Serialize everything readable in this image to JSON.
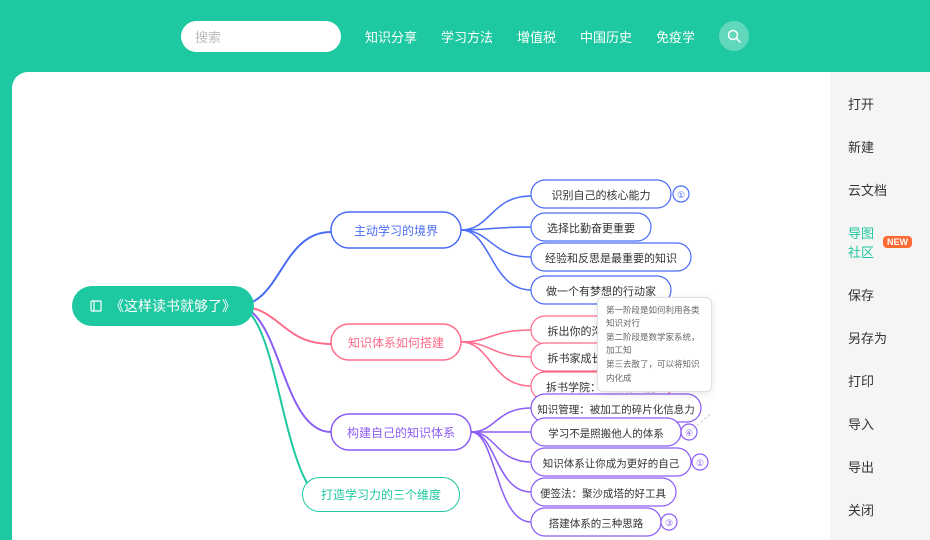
{
  "topbar": {
    "search_placeholder": "搜索",
    "nav_items": [
      "知识分享",
      "学习方法",
      "增值税",
      "中国历史",
      "免疫学"
    ]
  },
  "sidebar": {
    "items": [
      {
        "label": "打开",
        "active": false
      },
      {
        "label": "新建",
        "active": false
      },
      {
        "label": "云文档",
        "active": false
      },
      {
        "label": "导图社区",
        "active": true,
        "badge": "NEW"
      },
      {
        "label": "保存",
        "active": false
      },
      {
        "label": "另存为",
        "active": false
      },
      {
        "label": "打印",
        "active": false
      },
      {
        "label": "导入",
        "active": false
      },
      {
        "label": "导出",
        "active": false
      },
      {
        "label": "关闭",
        "active": false
      }
    ]
  },
  "mindmap": {
    "root": "《这样读书就够了》",
    "branches": [
      {
        "label": "主动学习的境界",
        "color": "#4a6cf7",
        "children": [
          {
            "label": "识别自己的核心能力",
            "hasIcon": true
          },
          {
            "label": "选择比勤奋更重要"
          },
          {
            "label": "经验和反思是最重要的知识"
          },
          {
            "label": "做一个有梦想的行动家"
          }
        ]
      },
      {
        "label": "知识体系如何搭建",
        "color": "#ff6b8a",
        "children": [
          {
            "label": "拆出你的沟通力",
            "hasIcon": true
          },
          {
            "label": "拆书家成长体系"
          },
          {
            "label": "拆书学院：为职场赋能"
          }
        ]
      },
      {
        "label": "构建自己的知识体系",
        "color": "#8b5cf6",
        "children": [
          {
            "label": "知识管理：被加工的碎片化信息力"
          },
          {
            "label": "学习不是照搬他人的体系",
            "hasIcon": true
          },
          {
            "label": "知识体系让你成为更好的自己",
            "hasIcon": true
          },
          {
            "label": "便签法：聚沙成塔的好工具"
          },
          {
            "label": "搭建体系的三种思路",
            "hasIcon": true
          }
        ]
      },
      {
        "label": "打造学习力的三个维度",
        "color": "#1ec8a0",
        "children": []
      }
    ],
    "tooltip": {
      "lines": [
        "第一阶段是如何利用各类知识对行",
        "第二阶段是数学家系统，加工知",
        "第三去散了，可以将知识内化成"
      ]
    }
  }
}
